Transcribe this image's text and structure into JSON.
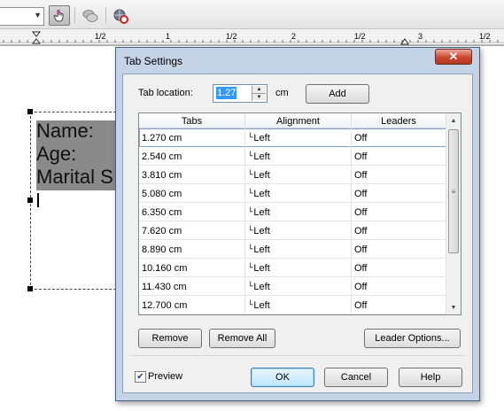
{
  "toolbar": {
    "icons": [
      "hand-pointer-icon",
      "chat-bubbles-icon",
      "globe-refresh-icon"
    ]
  },
  "ruler": {
    "marks": [
      "1/2",
      "1",
      "1/2",
      "2",
      "1/2",
      "3",
      "1/2"
    ]
  },
  "document": {
    "lines": [
      "Name:",
      "Age:",
      "Marital S"
    ]
  },
  "dialog": {
    "title": "Tab Settings",
    "close_label": "✕",
    "tab_location_label": "Tab location:",
    "tab_location_value": "1.27",
    "unit_label": "cm",
    "add_label": "Add",
    "columns": [
      "Tabs",
      "Alignment",
      "Leaders"
    ],
    "rows": [
      {
        "tab": "1.270 cm",
        "alignment": "Left",
        "leader": "Off",
        "selected": true
      },
      {
        "tab": "2.540 cm",
        "alignment": "Left",
        "leader": "Off"
      },
      {
        "tab": "3.810 cm",
        "alignment": "Left",
        "leader": "Off"
      },
      {
        "tab": "5.080 cm",
        "alignment": "Left",
        "leader": "Off"
      },
      {
        "tab": "6.350 cm",
        "alignment": "Left",
        "leader": "Off"
      },
      {
        "tab": "7.620 cm",
        "alignment": "Left",
        "leader": "Off"
      },
      {
        "tab": "8.890 cm",
        "alignment": "Left",
        "leader": "Off"
      },
      {
        "tab": "10.160 cm",
        "alignment": "Left",
        "leader": "Off"
      },
      {
        "tab": "11.430 cm",
        "alignment": "Left",
        "leader": "Off"
      },
      {
        "tab": "12.700 cm",
        "alignment": "Left",
        "leader": "Off"
      }
    ],
    "remove_label": "Remove",
    "remove_all_label": "Remove All",
    "leader_options_label": "Leader Options...",
    "preview_label": "Preview",
    "preview_checked": true,
    "ok_label": "OK",
    "cancel_label": "Cancel",
    "help_label": "Help"
  },
  "colors": {
    "dialog_frame": "#c5d3e6",
    "close_button": "#c8472e",
    "selection": "#3399ff",
    "text_shade": "#8a8a8a"
  }
}
